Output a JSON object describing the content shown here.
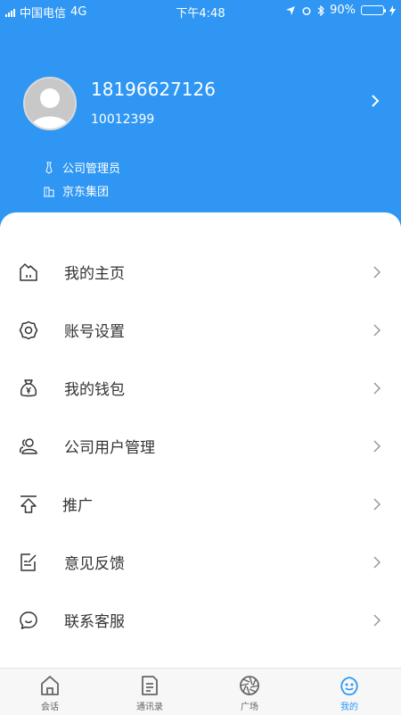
{
  "status_bar": {
    "carrier": "中国电信",
    "network": "4G",
    "time": "下午4:48",
    "battery": "90%",
    "battery_level": 0.9
  },
  "profile": {
    "phone": "18196627126",
    "user_id": "10012399",
    "role": "公司管理员",
    "company": "京东集团"
  },
  "menu": {
    "items": [
      {
        "label": "我的主页",
        "icon": "home-page-icon"
      },
      {
        "label": "账号设置",
        "icon": "settings-gear-icon"
      },
      {
        "label": "我的钱包",
        "icon": "wallet-bag-icon"
      },
      {
        "label": "公司用户管理",
        "icon": "users-icon"
      },
      {
        "label": "推广",
        "icon": "upload-arrow-icon"
      },
      {
        "label": "意见反馈",
        "icon": "feedback-edit-icon"
      },
      {
        "label": "联系客服",
        "icon": "chat-bubble-icon"
      }
    ]
  },
  "tabbar": {
    "tabs": [
      {
        "label": "会话",
        "icon": "home-icon"
      },
      {
        "label": "通讯录",
        "icon": "document-icon"
      },
      {
        "label": "广场",
        "icon": "aperture-icon"
      },
      {
        "label": "我的",
        "icon": "mine-face-icon",
        "active": true
      }
    ]
  },
  "colors": {
    "primary": "#2f97f3",
    "battery": "#32d74b",
    "text": "#333333"
  }
}
